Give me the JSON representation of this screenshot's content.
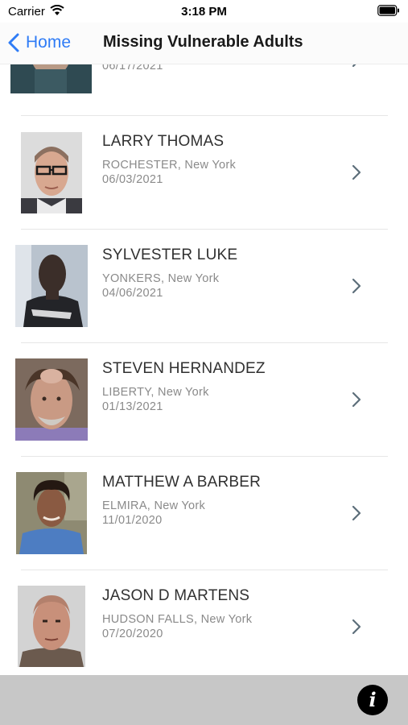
{
  "status_bar": {
    "carrier": "Carrier",
    "time": "3:18 PM"
  },
  "nav": {
    "back_label": "Home",
    "title": "Missing Vulnerable Adults"
  },
  "persons": [
    {
      "name": "",
      "location": "",
      "date": "06/17/2021"
    },
    {
      "name": "LARRY THOMAS",
      "location": "ROCHESTER, New York",
      "date": "06/03/2021"
    },
    {
      "name": "SYLVESTER LUKE",
      "location": "YONKERS, New York",
      "date": "04/06/2021"
    },
    {
      "name": "STEVEN HERNANDEZ",
      "location": "LIBERTY, New York",
      "date": "01/13/2021"
    },
    {
      "name": "MATTHEW A BARBER",
      "location": "ELMIRA, New York",
      "date": "11/01/2020"
    },
    {
      "name": "JASON D MARTENS",
      "location": "HUDSON FALLS, New York",
      "date": "07/20/2020"
    }
  ],
  "icons": {
    "back": "chevron-left-icon",
    "disclosure": "chevron-right-icon",
    "info": "info-icon",
    "info_glyph": "i"
  },
  "colors": {
    "accent": "#2f7cf6",
    "bottom_bar": "#c7c7c7",
    "nav_bg": "#fbfbfb"
  }
}
